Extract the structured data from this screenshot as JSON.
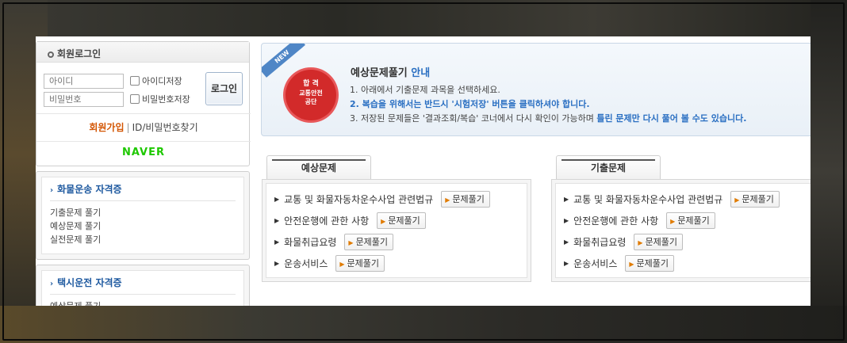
{
  "login": {
    "title": "회원로그인",
    "id_placeholder": "아이디",
    "pw_placeholder": "비밀번호",
    "save_id": "아이디저장",
    "save_pw": "비밀번호저장",
    "login_button": "로그인",
    "join": "회원가입",
    "separator": "|",
    "find": "ID/비밀번호찾기",
    "naver": "NAVER"
  },
  "sidebar": {
    "cargo": {
      "title": "화물운송 자격증",
      "items": [
        "기출문제 풀기",
        "예상문제 풀기",
        "실전문제 풀기"
      ]
    },
    "taxi": {
      "title": "택시운전 자격증",
      "items": [
        "예상문제 풀기"
      ]
    }
  },
  "notice": {
    "ribbon": "NEW",
    "seal_top": "합 격",
    "seal_mid": "교통안전",
    "seal_bottom": "공단",
    "title_main": "예상문제풀기",
    "title_hl": "안내",
    "line1": "1. 아래에서 기출문제 과목을 선택하세요.",
    "line2": "2. 복습을 위해서는 반드시 '시험저장' 버튼을 클릭하셔야 합니다.",
    "line3_a": "3. 저장된 문제들은 '결과조회/복습' 코너에서 다시 확인이 가능하며",
    "line3_b": "틀린 문제만 다시 풀어 볼 수도 있습니다."
  },
  "panels": {
    "expected": {
      "tab": "예상문제",
      "items": [
        {
          "label": "교통 및 화물자동차운수사업 관련법규",
          "button": "문제풀기"
        },
        {
          "label": "안전운행에 관한 사항",
          "button": "문제풀기"
        },
        {
          "label": "화물취급요령",
          "button": "문제풀기"
        },
        {
          "label": "운송서비스",
          "button": "문제풀기"
        }
      ]
    },
    "past": {
      "tab": "기출문제",
      "items": [
        {
          "label": "교통 및 화물자동차운수사업 관련법규",
          "button": "문제풀기"
        },
        {
          "label": "안전운행에 관한 사항",
          "button": "문제풀기"
        },
        {
          "label": "화물취급요령",
          "button": "문제풀기"
        },
        {
          "label": "운송서비스",
          "button": "문제풀기"
        }
      ]
    }
  },
  "colors": {
    "accent_blue": "#2a6fc2",
    "join_orange": "#d35400",
    "naver_green": "#1ec800",
    "seal_red": "#d22a2a"
  }
}
